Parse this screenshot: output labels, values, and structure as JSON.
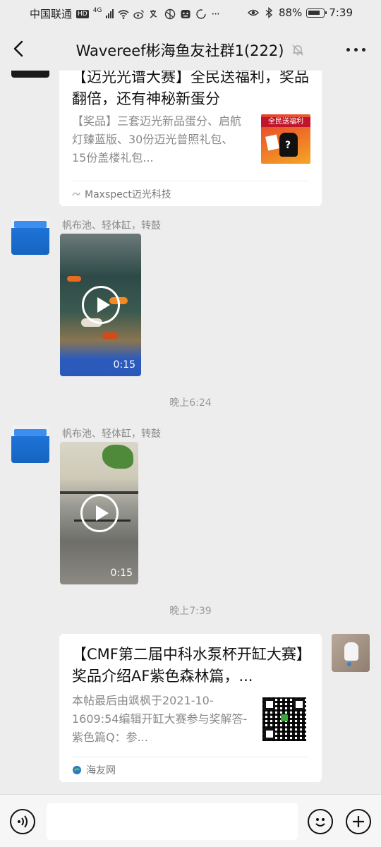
{
  "status_bar": {
    "carrier": "中国联通",
    "hd_badge": "HD",
    "network": "4G",
    "battery": "88%",
    "time": "7:39"
  },
  "header": {
    "title": "Wavereef彬海鱼友社群1(222)"
  },
  "messages": {
    "card1": {
      "title": "【迈光光谱大赛】全民送福利，奖品翻倍，还有神秘新蛋分",
      "desc": "【奖品】三套迈光新品蛋分、启航灯臻蓝版、30份迈光普照礼包、15份盖楼礼包...",
      "thumb_text": "全民送福利",
      "source": "Maxspect迈光科技"
    },
    "video1": {
      "sender": "帆布池、轻体缸，转鼓",
      "duration": "0:15"
    },
    "time1": "晚上6:24",
    "video2": {
      "sender": "帆布池、轻体缸，转鼓",
      "duration": "0:15"
    },
    "time2": "晚上7:39",
    "card2": {
      "title": "【CMF第二届中科水泵杯开缸大赛】奖品介绍AF紫色森林篇，...",
      "desc": "本帖最后由飒枫于2021-10-1609:54编辑开缸大赛参与奖解答-紫色篇Q：参...",
      "source": "海友网"
    }
  },
  "colors": {
    "background": "#ededed",
    "card": "#ffffff",
    "muted_text": "#888888"
  }
}
